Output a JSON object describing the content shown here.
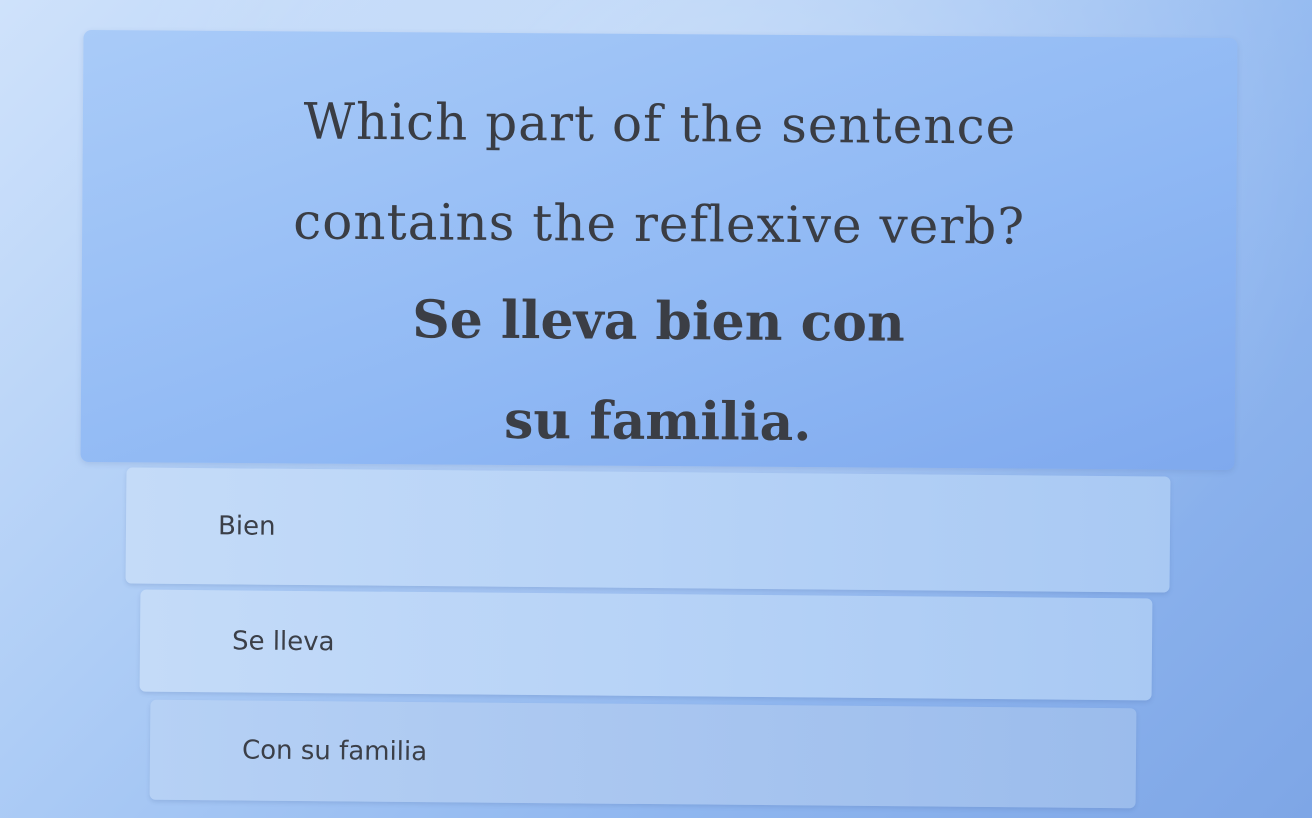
{
  "question": {
    "line1": "Which part of the sentence",
    "line2": "contains the reflexive  verb?",
    "sentence_line1": "Se lleva bien con",
    "sentence_line2": "su familia."
  },
  "options": [
    {
      "label": "Bien"
    },
    {
      "label": "Se lleva"
    },
    {
      "label": "Con su familia"
    }
  ]
}
